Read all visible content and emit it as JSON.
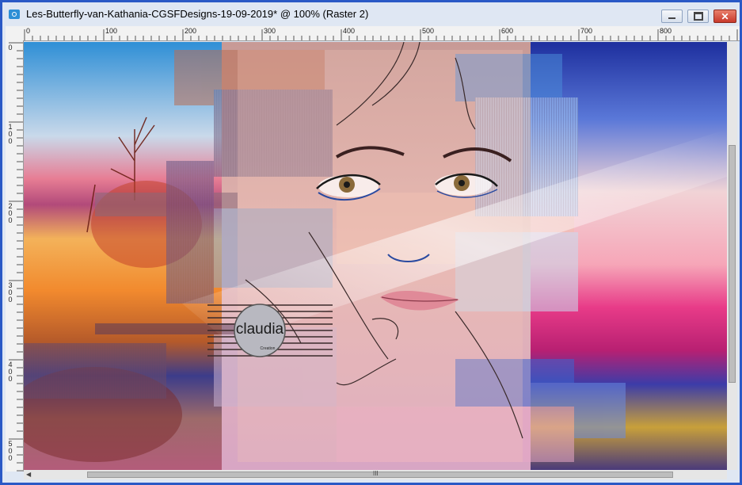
{
  "window": {
    "title": "Les-Butterfly-van-Kathania-CGSFDesigns-19-09-2019* @ 100% (Raster 2)",
    "controls": {
      "minimize": "",
      "maximize": "",
      "close": "✕"
    }
  },
  "ruler": {
    "top_labels": [
      "0",
      "100",
      "200",
      "300",
      "400",
      "500",
      "600",
      "700",
      "800"
    ],
    "left_labels": [
      "0",
      "1\n0\n0",
      "2\n0\n0",
      "3\n0\n0",
      "4\n0\n0",
      "5\n0\n0"
    ]
  },
  "artwork": {
    "watermark_text": "claudia",
    "watermark_subtext": "Creation"
  },
  "scrollbar": {
    "grip": "III"
  }
}
